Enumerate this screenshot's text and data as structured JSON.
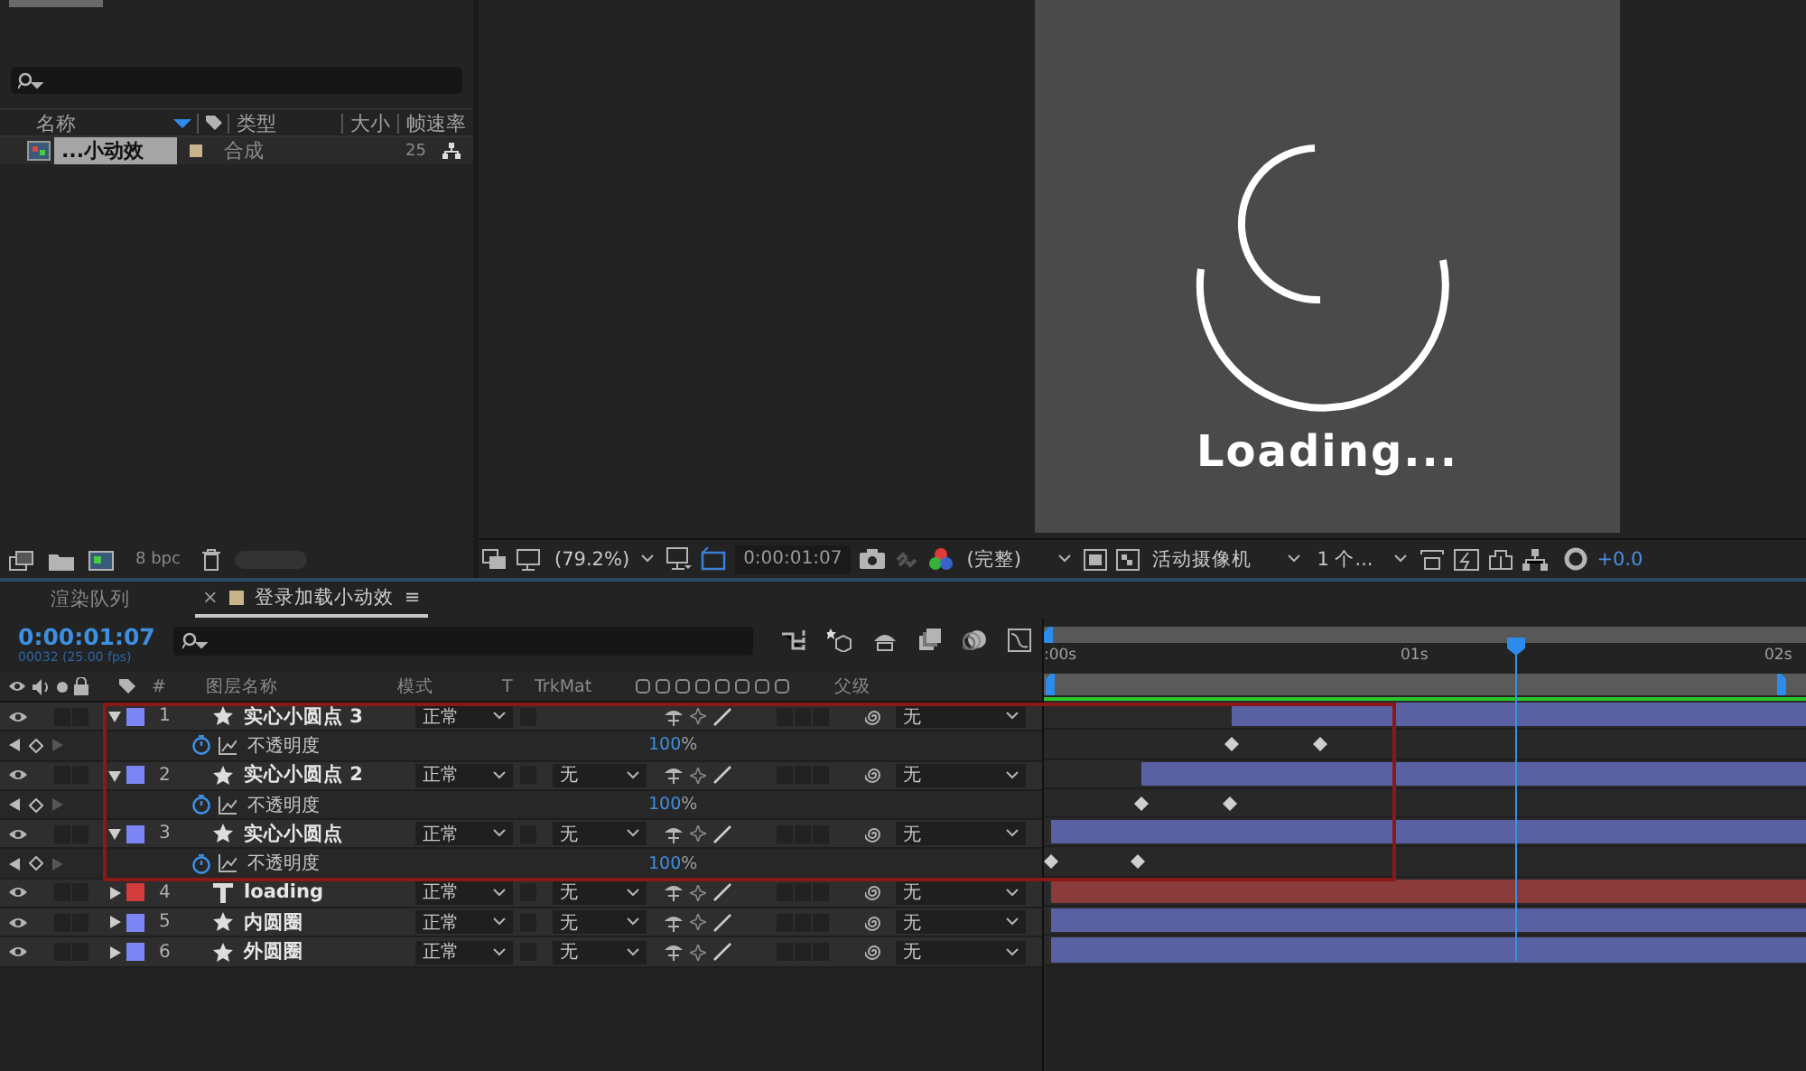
{
  "project": {
    "columns": [
      "名称",
      "类型",
      "大小",
      "帧速率"
    ],
    "items": [
      {
        "name": "...小动效",
        "type": "合成",
        "fps": "25",
        "selected": true,
        "color": "#c8b48a"
      }
    ],
    "bit_depth": "8 bpc"
  },
  "viewer": {
    "overlay_text": "Loading...",
    "zoom": "(79.2%)",
    "timecode": "0:00:01:07",
    "resolution": "(完整)",
    "camera": "活动摄像机",
    "views": "1 个...",
    "exposure": "+0.0"
  },
  "timeline": {
    "tabs": [
      {
        "label": "渲染队列",
        "selected": false
      },
      {
        "label": "登录加载小动效",
        "selected": true,
        "close": "×",
        "menu": "≡",
        "color": "#c8b48a"
      }
    ],
    "current_time": "0:00:01:07",
    "frame_info": "00032 (25.00 fps)",
    "columns": {
      "number": "#",
      "name": "图层名称",
      "mode": "模式",
      "t": "T",
      "trkmat": "TrkMat",
      "parent": "父级"
    },
    "ruler": [
      ":00s",
      "01s",
      "02s"
    ],
    "layers": [
      {
        "number": "1",
        "name": "实心小圆点 3",
        "kind": "solid",
        "color": "#7b86f4",
        "expanded": true,
        "mode": "正常",
        "parent": "无",
        "level": 0.76,
        "properties": [
          {
            "name": "不透明度",
            "value": "100",
            "unit": "%"
          }
        ]
      },
      {
        "number": "2",
        "name": "实心小圆点 2",
        "kind": "solid",
        "color": "#7b86f4",
        "expanded": true,
        "mode": "正常",
        "trkmat": "无",
        "parent": "无",
        "level": 0.88,
        "properties": [
          {
            "name": "不透明度",
            "value": "100",
            "unit": "%"
          }
        ]
      },
      {
        "number": "3",
        "name": "实心小圆点",
        "kind": "solid",
        "color": "#7b86f4",
        "expanded": true,
        "mode": "正常",
        "trkmat": "无",
        "parent": "无",
        "level": 1,
        "properties": [
          {
            "name": "不透明度",
            "value": "100",
            "unit": "%"
          }
        ]
      },
      {
        "number": "4",
        "name": "loading",
        "kind": "text",
        "color": "#d23c3c",
        "expanded": false,
        "mode": "正常",
        "trkmat": "无",
        "parent": "无",
        "level": 1
      },
      {
        "number": "5",
        "name": "内圆圈",
        "kind": "solid",
        "color": "#7b86f4",
        "expanded": false,
        "mode": "正常",
        "trkmat": "无",
        "parent": "无",
        "level": 1
      },
      {
        "number": "6",
        "name": "外圆圈",
        "kind": "solid",
        "color": "#7b86f4",
        "expanded": false,
        "mode": "正常",
        "trkmat": "无",
        "parent": "无",
        "level": 1
      }
    ]
  }
}
